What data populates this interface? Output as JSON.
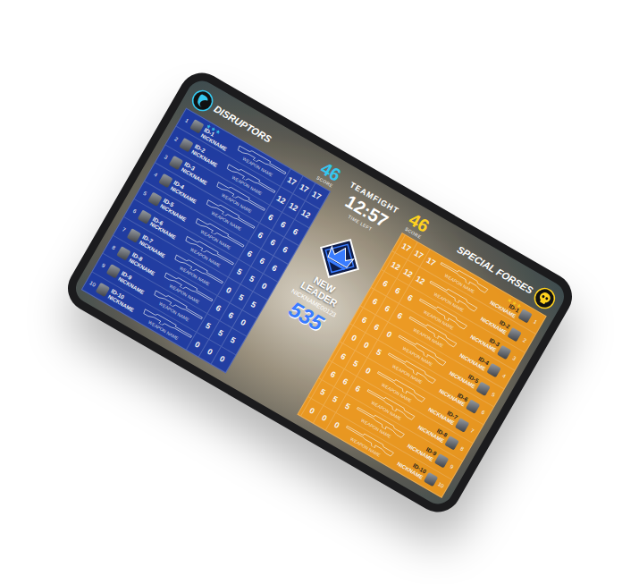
{
  "match": {
    "mode": "TEAMFIGHT",
    "time": "12:57",
    "time_label": "TIME LEFT"
  },
  "leader": {
    "title": "NEW LEADER",
    "nickname": "NICKNAME00123",
    "score": "535"
  },
  "teams": [
    {
      "name": "DISRUPTORS",
      "side": "left",
      "score": "46",
      "score_label": "SCORE",
      "color": "#1b3aa6",
      "accent": "#35c8f0",
      "players": [
        {
          "rank": "1",
          "id": "ID-1",
          "nickname": "NICKNAME",
          "weapon": "WEAPON NAME",
          "stars": 3,
          "stats": [
            "17",
            "17",
            "17"
          ]
        },
        {
          "rank": "2",
          "id": "ID-2",
          "nickname": "NICKNAME",
          "weapon": "WEAPON NAME",
          "stars": 0,
          "stats": [
            "12",
            "12",
            "12"
          ]
        },
        {
          "rank": "3",
          "id": "ID-3",
          "nickname": "NICKNAME",
          "weapon": "WEAPON NAME",
          "stars": 0,
          "stats": [
            "6",
            "6",
            "6"
          ]
        },
        {
          "rank": "4",
          "id": "ID-4",
          "nickname": "NICKNAME",
          "weapon": "WEAPON NAME",
          "stars": 0,
          "stats": [
            "6",
            "6",
            "6"
          ]
        },
        {
          "rank": "5",
          "id": "ID-5",
          "nickname": "NICKNAME",
          "weapon": "WEAPON NAME",
          "stars": 0,
          "stats": [
            "6",
            "6",
            "6"
          ]
        },
        {
          "rank": "6",
          "id": "ID-6",
          "nickname": "NICKNAME",
          "weapon": "WEAPON NAME",
          "stars": 0,
          "stats": [
            "5",
            "5",
            "0"
          ]
        },
        {
          "rank": "7",
          "id": "ID-7",
          "nickname": "NICKNAME",
          "weapon": "WEAPON NAME",
          "stars": 0,
          "stats": [
            "0",
            "5",
            "5"
          ]
        },
        {
          "rank": "8",
          "id": "ID-8",
          "nickname": "NICKNAME",
          "weapon": "WEAPON NAME",
          "stars": 0,
          "stats": [
            "6",
            "6",
            "0"
          ]
        },
        {
          "rank": "9",
          "id": "ID-9",
          "nickname": "NICKNAME",
          "weapon": "WEAPON NAME",
          "stars": 0,
          "stats": [
            "5",
            "5",
            "5"
          ]
        },
        {
          "rank": "10",
          "id": "ID-10",
          "nickname": "NICKNAME",
          "weapon": "WEAPON NAME",
          "stars": 0,
          "stats": [
            "0",
            "0",
            "0"
          ]
        }
      ]
    },
    {
      "name": "SPECIAL FORSES",
      "side": "right",
      "score": "46",
      "score_label": "SCORE",
      "color": "#f29a1c",
      "accent": "#ffd21f",
      "players": [
        {
          "rank": "1",
          "id": "ID-1",
          "nickname": "NICKNAME",
          "weapon": "WEAPON NAME",
          "stars": 3,
          "stats": [
            "17",
            "17",
            "17"
          ]
        },
        {
          "rank": "2",
          "id": "ID-2",
          "nickname": "NICKNAME",
          "weapon": "WEAPON NAME",
          "stars": 0,
          "stats": [
            "12",
            "12",
            "12"
          ]
        },
        {
          "rank": "3",
          "id": "ID-3",
          "nickname": "NICKNAME",
          "weapon": "WEAPON NAME",
          "stars": 0,
          "stats": [
            "6",
            "6",
            "6"
          ]
        },
        {
          "rank": "4",
          "id": "ID-4",
          "nickname": "NICKNAME",
          "weapon": "WEAPON NAME",
          "stars": 0,
          "stats": [
            "6",
            "6",
            "6"
          ]
        },
        {
          "rank": "5",
          "id": "ID-5",
          "nickname": "NICKNAME",
          "weapon": "WEAPON NAME",
          "stars": 0,
          "stats": [
            "0",
            "6",
            "6"
          ]
        },
        {
          "rank": "6",
          "id": "ID-6",
          "nickname": "NICKNAME",
          "weapon": "WEAPON NAME",
          "stars": 0,
          "stats": [
            "5",
            "0",
            "0"
          ]
        },
        {
          "rank": "7",
          "id": "ID-7",
          "nickname": "NICKNAME",
          "weapon": "WEAPON NAME",
          "stars": 0,
          "stats": [
            "0",
            "5",
            "6"
          ]
        },
        {
          "rank": "8",
          "id": "ID-8",
          "nickname": "NICKNAME",
          "weapon": "WEAPON NAME",
          "stars": 0,
          "stats": [
            "6",
            "6",
            "6"
          ]
        },
        {
          "rank": "9",
          "id": "ID-9",
          "nickname": "NICKNAME",
          "weapon": "WEAPON NAME",
          "stars": 0,
          "stats": [
            "5",
            "5",
            "5"
          ]
        },
        {
          "rank": "10",
          "id": "ID-10",
          "nickname": "NICKNAME",
          "weapon": "WEAPON NAME",
          "stars": 0,
          "stats": [
            "0",
            "0",
            "0"
          ]
        }
      ]
    }
  ]
}
